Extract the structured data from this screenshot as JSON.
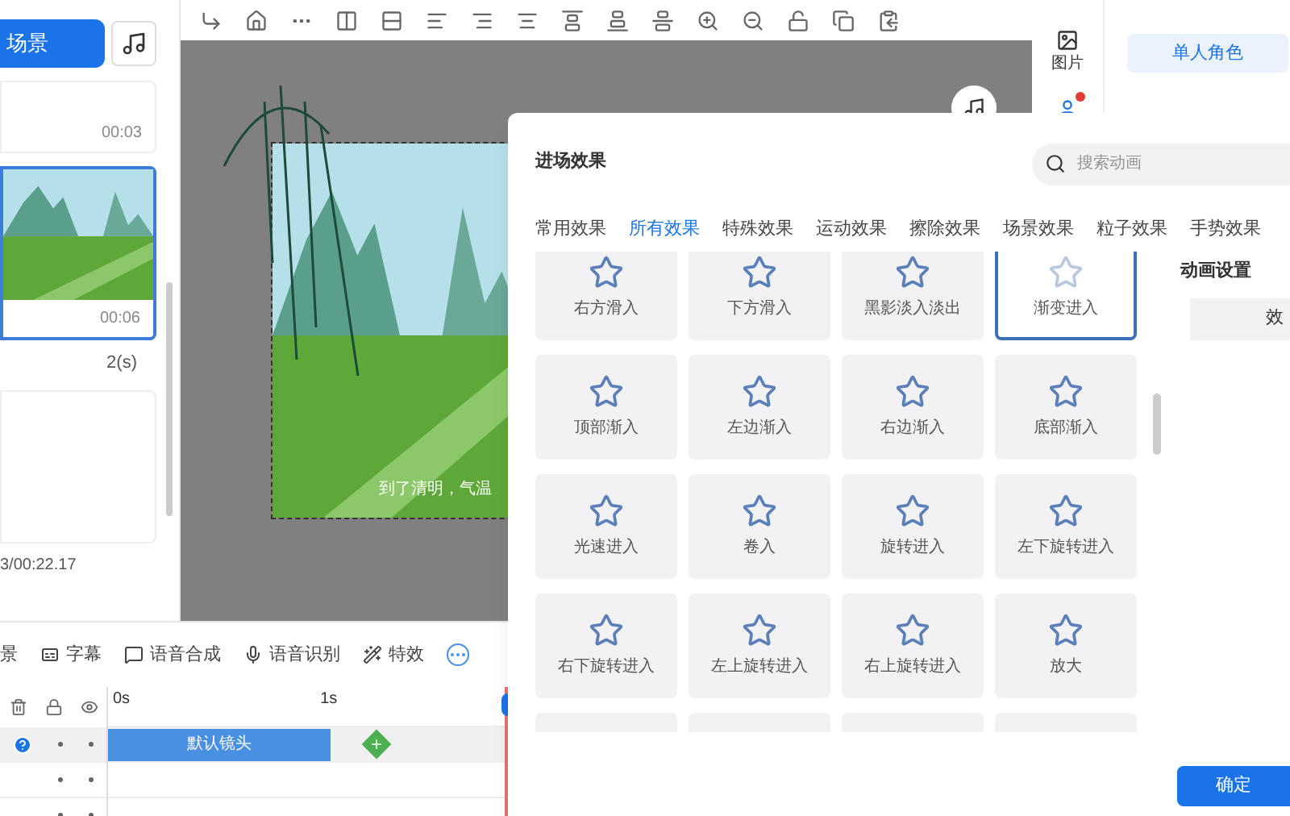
{
  "left_panel": {
    "scene_button": "场景",
    "scenes": [
      {
        "kind": "empty",
        "duration": "00:03",
        "selected": false
      },
      {
        "kind": "image",
        "duration": "00:06",
        "selected": true
      },
      {
        "kind": "empty",
        "selected": false
      }
    ],
    "transition_time": "2(s)",
    "total_time": "3/00:22.17"
  },
  "canvas": {
    "subtitle": "到了清明，气温"
  },
  "right_panel": {
    "image_tab": "图片",
    "role_button": "单人角色"
  },
  "bottom_toolbar": {
    "items": [
      {
        "kind": "scene",
        "label": "景"
      },
      {
        "kind": "caption",
        "label": "字幕"
      },
      {
        "kind": "tts",
        "label": "语音合成"
      },
      {
        "kind": "asr",
        "label": "语音识别"
      },
      {
        "kind": "effect",
        "label": "特效"
      }
    ]
  },
  "timeline": {
    "ticks": [
      "0s",
      "1s"
    ],
    "clip": "默认镜头",
    "rows": [
      {
        "selected": true
      },
      {
        "selected": false
      },
      {
        "selected": false
      }
    ]
  },
  "modal": {
    "title": "进场效果",
    "search": {
      "placeholder": "搜索动画"
    },
    "tabs": [
      {
        "label": "常用效果",
        "selected": false
      },
      {
        "label": "所有效果",
        "selected": true
      },
      {
        "label": "特殊效果",
        "selected": false
      },
      {
        "label": "运动效果",
        "selected": false
      },
      {
        "label": "擦除效果",
        "selected": false
      },
      {
        "label": "场景效果",
        "selected": false
      },
      {
        "label": "粒子效果",
        "selected": false
      },
      {
        "label": "手势效果",
        "selected": false
      }
    ],
    "effects": [
      {
        "label": "右方滑入",
        "selected": false
      },
      {
        "label": "下方滑入",
        "selected": false
      },
      {
        "label": "黑影淡入淡出",
        "selected": false
      },
      {
        "label": "渐变进入",
        "selected": true
      },
      {
        "label": "顶部渐入",
        "selected": false
      },
      {
        "label": "左边渐入",
        "selected": false
      },
      {
        "label": "右边渐入",
        "selected": false
      },
      {
        "label": "底部渐入",
        "selected": false
      },
      {
        "label": "光速进入",
        "selected": false
      },
      {
        "label": "卷入",
        "selected": false
      },
      {
        "label": "旋转进入",
        "selected": false
      },
      {
        "label": "左下旋转进入",
        "selected": false
      },
      {
        "label": "右下旋转进入",
        "selected": false
      },
      {
        "label": "左上旋转进入",
        "selected": false
      },
      {
        "label": "右上旋转进入",
        "selected": false
      },
      {
        "label": "放大",
        "selected": false
      }
    ],
    "settings_title": "动画设置",
    "settings_button": "效",
    "confirm": "确定"
  }
}
